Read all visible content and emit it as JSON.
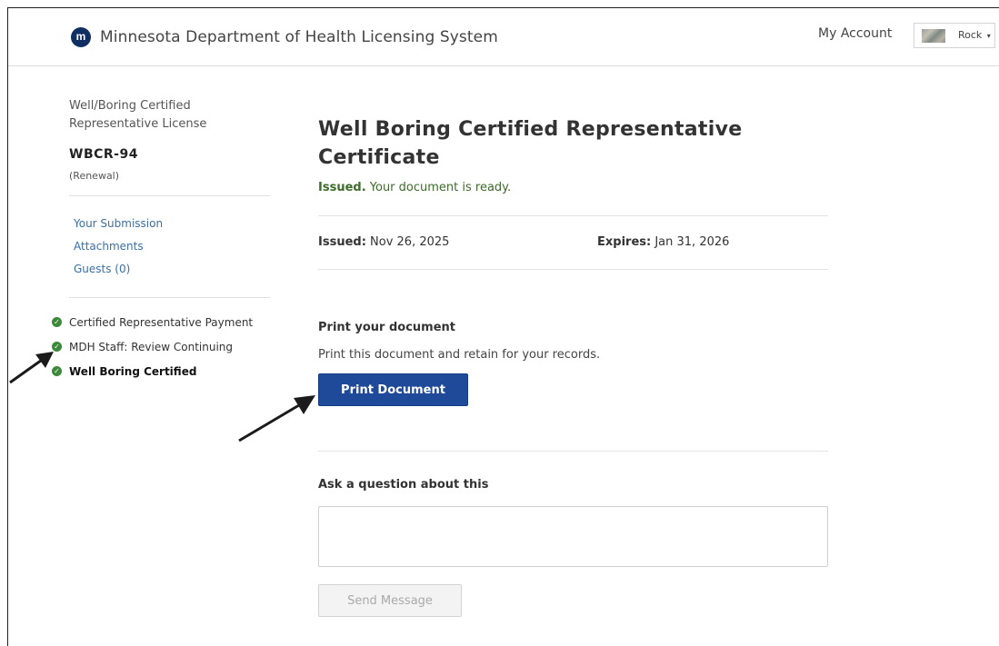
{
  "header": {
    "logo_glyph": "m",
    "app_title": "Minnesota Department of Health Licensing System",
    "my_account_label": "My Account",
    "user_name": "Rock",
    "user_caret": "▾"
  },
  "sidebar": {
    "license_title": "Well/Boring Certified Representative License",
    "license_code": "WBCR-94",
    "license_type": "(Renewal)",
    "links": [
      {
        "label": "Your Submission"
      },
      {
        "label": "Attachments"
      },
      {
        "label": "Guests (0)"
      }
    ],
    "steps": [
      {
        "label": "Certified Representative Payment",
        "status": "complete"
      },
      {
        "label": "MDH Staff: Review Continuing",
        "status": "complete"
      },
      {
        "label": "Well Boring Certified",
        "status": "complete",
        "active": true
      }
    ],
    "check_glyph": "✓"
  },
  "main": {
    "title": "Well Boring Certified Representative Certificate",
    "status_bold": "Issued.",
    "status_text": " Your document is ready.",
    "issued_label": "Issued:",
    "issued_value": " Nov 26, 2025",
    "expires_label": "Expires:",
    "expires_value": " Jan 31, 2026",
    "print_heading": "Print your document",
    "print_subtext": "Print this document and retain for your records.",
    "print_button_label": "Print Document",
    "ask_heading": "Ask a question about this",
    "ask_value": "",
    "send_button_label": "Send Message"
  },
  "colors": {
    "primary_button": "#1f4a9a",
    "link": "#3a6fa6",
    "status_green": "#3d6b2a",
    "check_green": "#3a8a3a",
    "logo_navy": "#0f2f63"
  }
}
